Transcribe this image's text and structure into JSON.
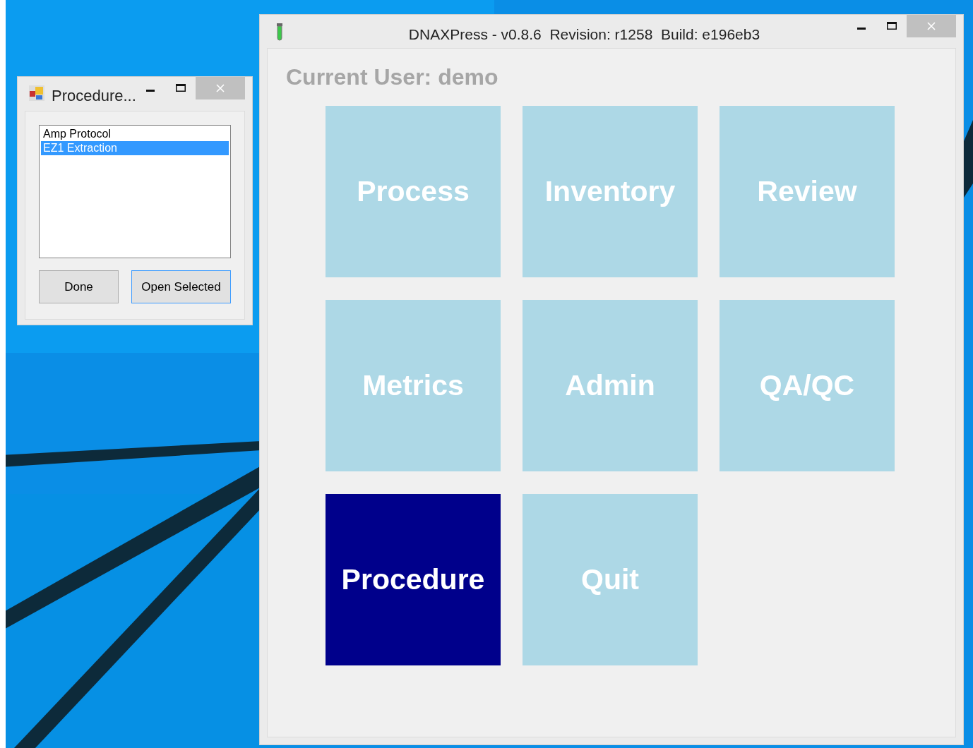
{
  "procedure_window": {
    "title": "Procedure...",
    "list_items": [
      {
        "label": "Amp Protocol",
        "selected": false
      },
      {
        "label": "EZ1 Extraction",
        "selected": true
      }
    ],
    "buttons": [
      {
        "label": "Done",
        "focused": false
      },
      {
        "label": "Open Selected",
        "focused": true
      }
    ]
  },
  "main_window": {
    "title": "DNAXPress - v0.8.6  Revision: r1258  Build: e196eb3",
    "current_user": "Current User: demo",
    "tiles": [
      {
        "label": "Process",
        "selected": false
      },
      {
        "label": "Inventory",
        "selected": false
      },
      {
        "label": "Review",
        "selected": false
      },
      {
        "label": "Metrics",
        "selected": false
      },
      {
        "label": "Admin",
        "selected": false
      },
      {
        "label": "QA/QC",
        "selected": false
      },
      {
        "label": "Procedure",
        "selected": true
      },
      {
        "label": "Quit",
        "selected": false
      }
    ]
  }
}
